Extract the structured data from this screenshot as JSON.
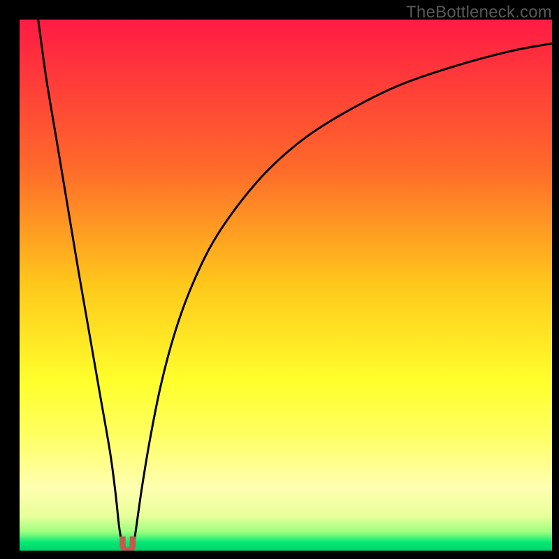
{
  "watermark": "TheBottleneck.com",
  "chart_data": {
    "type": "line",
    "title": "",
    "xlabel": "",
    "ylabel": "",
    "xlim": [
      0,
      100
    ],
    "ylim": [
      0,
      100
    ],
    "gradient_stops": [
      {
        "offset": 0.0,
        "color": "#ff1b44"
      },
      {
        "offset": 0.28,
        "color": "#ff6a2a"
      },
      {
        "offset": 0.5,
        "color": "#ffc81b"
      },
      {
        "offset": 0.68,
        "color": "#ffff2c"
      },
      {
        "offset": 0.78,
        "color": "#ffff61"
      },
      {
        "offset": 0.88,
        "color": "#ffffb0"
      },
      {
        "offset": 0.935,
        "color": "#e8ff9a"
      },
      {
        "offset": 0.965,
        "color": "#9cff80"
      },
      {
        "offset": 0.985,
        "color": "#00e874"
      },
      {
        "offset": 1.0,
        "color": "#00d36b"
      }
    ],
    "series": [
      {
        "name": "left-branch",
        "x": [
          3.5,
          5,
          7,
          9,
          11,
          13,
          15,
          17,
          18,
          18.7,
          19.2
        ],
        "y": [
          100,
          89,
          77,
          65,
          53,
          41.5,
          30,
          18.5,
          11,
          4.5,
          1.5
        ]
      },
      {
        "name": "right-branch",
        "x": [
          21.5,
          22,
          23,
          24.5,
          26.5,
          29,
          32,
          36,
          41,
          47,
          54,
          62,
          71,
          81,
          92,
          100
        ],
        "y": [
          1.5,
          5,
          12,
          21,
          31,
          40.5,
          49,
          57.5,
          65,
          72,
          78,
          83,
          87.5,
          91,
          94,
          95.5
        ]
      }
    ],
    "marker": {
      "name": "notch-marker",
      "cx": 20.3,
      "cy": 1.3,
      "color": "#c55a4a"
    }
  }
}
